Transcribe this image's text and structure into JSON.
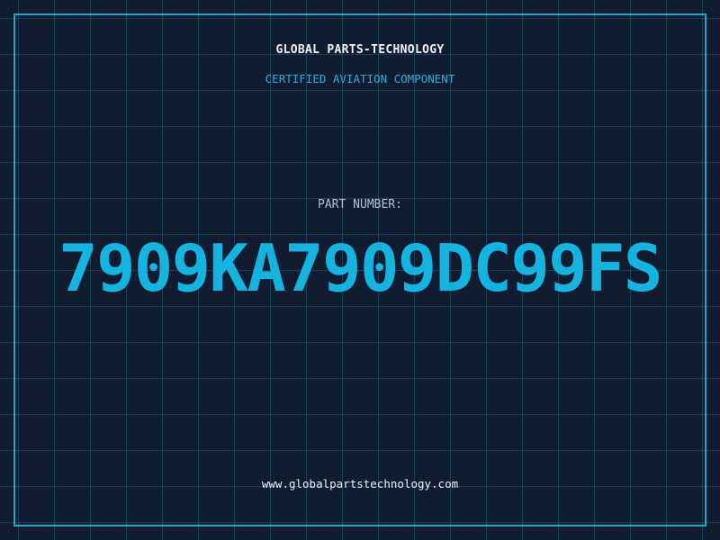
{
  "header": {
    "company": "GLOBAL PARTS-TECHNOLOGY",
    "subtitle": "CERTIFIED AVIATION COMPONENT"
  },
  "part": {
    "label": "PART NUMBER:",
    "number": "7909KA7909DC99FS"
  },
  "footer": {
    "url": "www.globalpartstechnology.com"
  },
  "colors": {
    "background": "#111c30",
    "grid": "#286e8c",
    "frame": "#1aa7cf",
    "accent": "#15b3e0",
    "subtitle": "#22b2dc",
    "label": "#b6c0cc",
    "text": "#f2f5f8"
  }
}
